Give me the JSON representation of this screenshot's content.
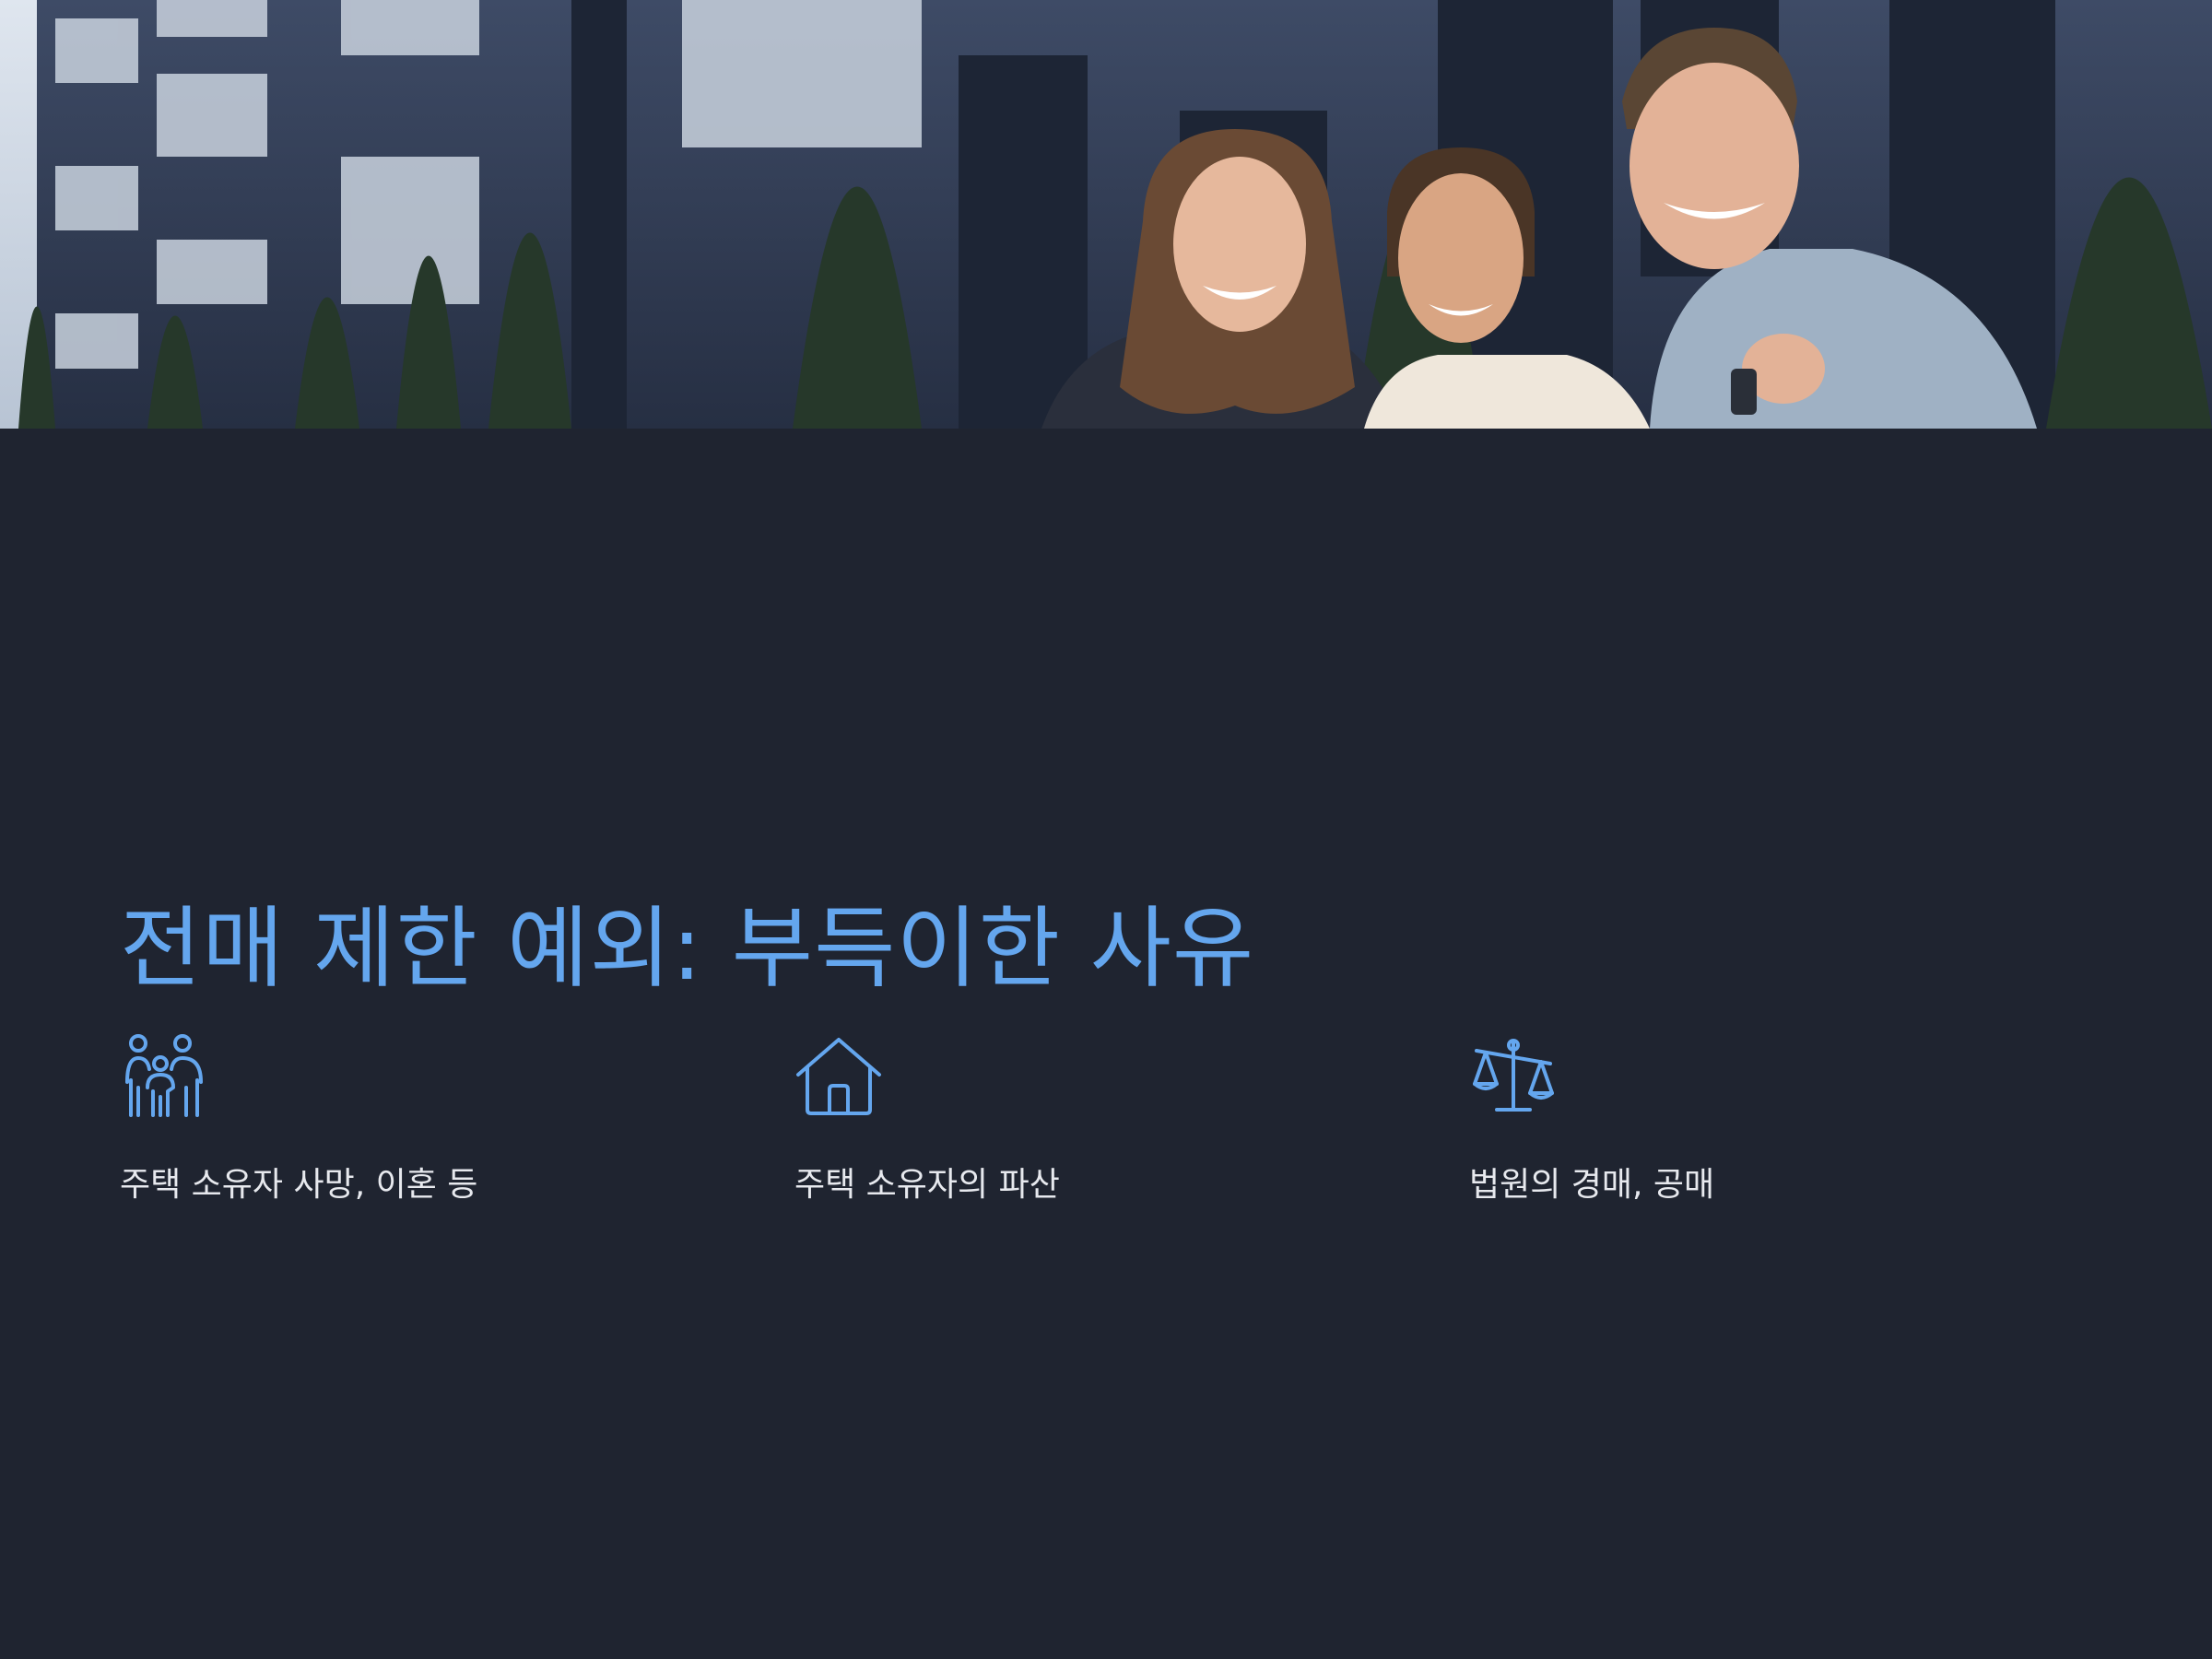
{
  "colors": {
    "background": "#1f2430",
    "accent": "#64a6ee",
    "text": "#e7e9ee"
  },
  "hero": {
    "image": "photo-three-smiling-people-holding-keys-in-front-of-apartment-building"
  },
  "title": "전매 제한 예외: 부득이한 사유",
  "features": [
    {
      "icon": "family-icon",
      "label": "주택 소유자 사망, 이혼 등"
    },
    {
      "icon": "house-icon",
      "label": "주택 소유자의 파산"
    },
    {
      "icon": "scales-icon",
      "label": "법원의 경매, 공매"
    }
  ]
}
